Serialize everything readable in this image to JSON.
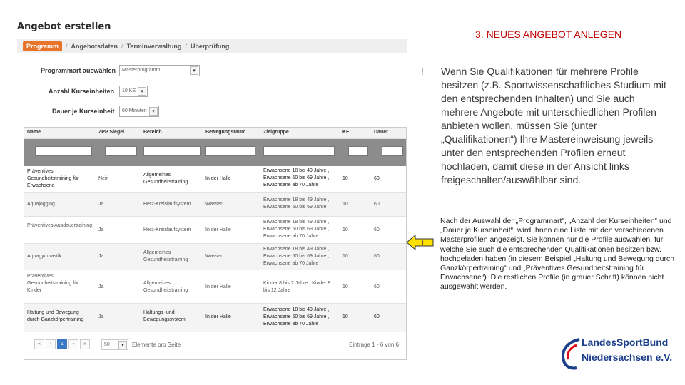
{
  "app": {
    "title": "Angebot erstellen"
  },
  "slide": {
    "title": "3. NEUES ANGEBOT ANLEGEN"
  },
  "breadcrumb": {
    "items": [
      "Programm",
      "Angebotsdaten",
      "Terminverwaltung",
      "Überprüfung"
    ],
    "separator": "/"
  },
  "form": {
    "programmart_label": "Programmart auswählen",
    "programmart_value": "Masterprogramm",
    "kurseinheiten_label": "Anzahl Kurseinheiten",
    "kurseinheiten_value": "10 KE",
    "dauer_label": "Dauer je Kurseinheit",
    "dauer_value": "60 Minuten"
  },
  "grid": {
    "columns": [
      "Name",
      "ZPP Siegel",
      "Bereich",
      "Bewegungsraum",
      "Zielgruppe",
      "KE",
      "Dauer"
    ],
    "rows": [
      {
        "name": "Präventives Gesundheitstraining für Erwachsene",
        "siegel": "Nein",
        "bereich": "Allgemeines Gesundheitstraining",
        "raum": "In der Halle",
        "zielgruppe": "Erwachsene 18 bis 49 Jahre , Erwachsene 50 bis 69 Jahre , Erwachsene ab 70 Jahre",
        "ke": "10",
        "dauer": "60"
      },
      {
        "name": "Aquajogging",
        "siegel": "Ja",
        "bereich": "Herz-Kreislaufsystem",
        "raum": "Wasser",
        "zielgruppe": "Erwachsene 18 bis 49 Jahre , Erwachsene 50 bis 69 Jahre",
        "ke": "10",
        "dauer": "60"
      },
      {
        "name": "Präventives Ausdauertraining",
        "siegel": "Ja",
        "bereich": "Herz-Kreislaufsystem",
        "raum": "In der Halle",
        "zielgruppe": "Erwachsene 18 bis 49 Jahre , Erwachsene 50 bis 69 Jahre , Erwachsene ab 70 Jahre",
        "ke": "10",
        "dauer": "60"
      },
      {
        "name": "Aquagymnastik",
        "siegel": "Ja",
        "bereich": "Allgemeines Gesundheitstraining",
        "raum": "Wasser",
        "zielgruppe": "Erwachsene 18 bis 49 Jahre , Erwachsene 50 bis 69 Jahre , Erwachsene ab 70 Jahre",
        "ke": "10",
        "dauer": "60"
      },
      {
        "name": "Präventives Gesundheitstraining für Kinder",
        "siegel": "Ja",
        "bereich": "Allgemeines Gesundheitstraining",
        "raum": "In der Halle",
        "zielgruppe": "Kinder 8 bis 7 Jahre , Kinder 8 bis 12 Jahre",
        "ke": "10",
        "dauer": "60"
      },
      {
        "name": "Haltung und Bewegung durch Ganzkörpertraining",
        "siegel": "Ja",
        "bereich": "Haltungs- und Bewegungssystem",
        "raum": "In der Halle",
        "zielgruppe": "Erwachsene 18 bis 49 Jahre , Erwachsene 50 bis 69 Jahre , Erwachsene ab 70 Jahre",
        "ke": "10",
        "dauer": "60"
      }
    ],
    "pager": {
      "first": "«",
      "prev": "‹",
      "current": "1",
      "next": "›",
      "last": "»",
      "page_size": "50",
      "page_size_label": "Elemente pro Seite",
      "summary": "Eintrage 1 - 6 von 6"
    }
  },
  "bullet": {
    "marker": "!",
    "text": "Wenn Sie Qualifikationen für mehrere Profile besitzen (z.B. Sportwissenschaftliches Studium mit den entsprechenden Inhalten) und Sie auch mehrere Angebote mit unterschiedlichen Profilen anbieten wollen, müssen Sie (unter „Qualifikationen“) Ihre Mastereinweisung jeweils unter den entsprechenden Profilen erneut hochladen, damit diese in der Ansicht links freigeschalten/auswählbar sind."
  },
  "arrow": {
    "label": "1"
  },
  "description": {
    "text": "Nach der Auswahl der „Programmart“, „Anzahl der Kurseinheiten“ und „Dauer je Kurseinheit“, wird Ihnen eine Liste mit den verschiedenen Masterprofilen angezeigt. Sie können nur die Profile auswählen, für welche Sie auch die entsprechenden Qualifikationen besitzen bzw. hochgeladen haben (in diesem Beispiel „Haltung und Bewegung durch Ganzkörpertraining“ und „Präventives Gesundheitstraining für Erwachsene“). Die restlichen Profile (in grauer Schrift) können nicht ausgewählt werden."
  },
  "logo": {
    "line1a": "Landes",
    "line1b": "SportBund",
    "line2": "Niedersachsen e.V."
  },
  "colors": {
    "accent": "#e8742b",
    "slide_title": "#c00000",
    "logo_blue": "#1b3f8a",
    "arrow_fill": "#ffe100",
    "pager_active": "#3a78c5"
  }
}
